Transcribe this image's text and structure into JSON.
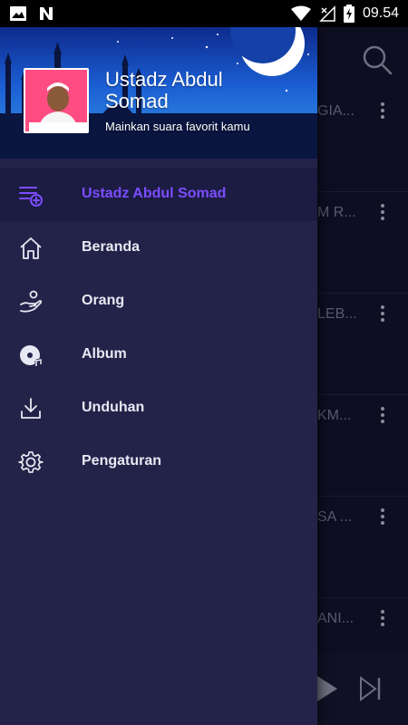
{
  "status_bar": {
    "time": "09.54",
    "icons": [
      "image-icon",
      "n-notification-icon",
      "wifi-icon",
      "no-signal-icon",
      "battery-charging-icon"
    ]
  },
  "header": {
    "title": "Ustadz Abdul Somad",
    "subtitle": "Mainkan suara favorit kamu",
    "avatar_caption": "Ustadz Abdul Somad"
  },
  "menu": {
    "items": [
      {
        "label": "Ustadz Abdul Somad",
        "icon": "playlist-add-icon",
        "active": true
      },
      {
        "label": "Beranda",
        "icon": "home-icon",
        "active": false
      },
      {
        "label": "Orang",
        "icon": "person-hand-icon",
        "active": false
      },
      {
        "label": "Album",
        "icon": "album-disc-icon",
        "active": false
      },
      {
        "label": "Unduhan",
        "icon": "download-icon",
        "active": false
      },
      {
        "label": "Pengaturan",
        "icon": "settings-gear-icon",
        "active": false
      }
    ]
  },
  "background_list": {
    "rows": [
      {
        "title_fragment": "GIA..."
      },
      {
        "title_fragment": "M R..."
      },
      {
        "title_fragment": "LEB..."
      },
      {
        "title_fragment": "KM..."
      },
      {
        "title_fragment": "SA ..."
      },
      {
        "title_fragment": "ANI..."
      }
    ]
  },
  "colors": {
    "drawer_bg": "#23234a",
    "active_accent": "#7b4dff",
    "menu_text": "#e8e8f2"
  }
}
